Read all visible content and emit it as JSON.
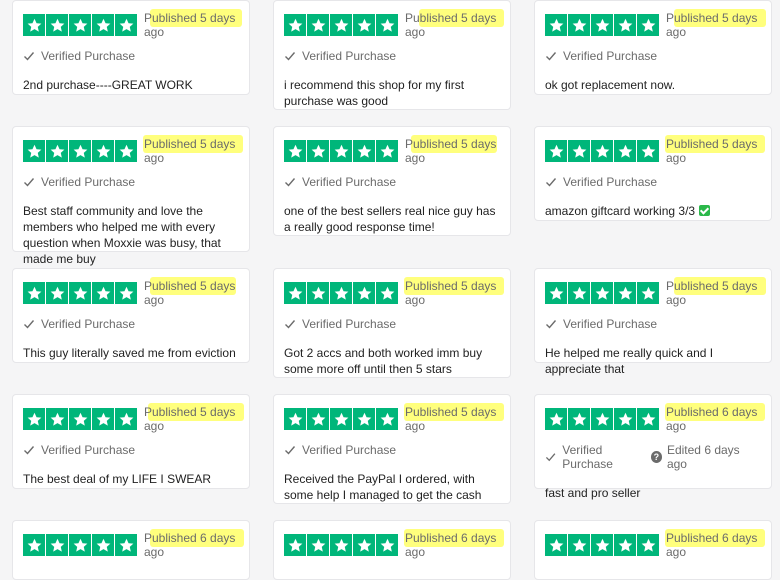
{
  "reviews": [
    {
      "published": "Published 5 days ago",
      "verified": "Verified Purchase",
      "text": "2nd purchase----GREAT WORK",
      "edited": ""
    },
    {
      "published": "Published 5 days ago",
      "verified": "Verified Purchase",
      "text": "i recommend this shop for my first purchase was good",
      "edited": ""
    },
    {
      "published": "Published 5 days ago",
      "verified": "Verified Purchase",
      "text": "ok got replacement now.",
      "edited": ""
    },
    {
      "published": "Published 5 days ago",
      "verified": "Verified Purchase",
      "text": "Best staff community and love the members who helped me with every question when Moxxie was busy, that made me buy",
      "edited": ""
    },
    {
      "published": "Published 5 days ago",
      "verified": "Verified Purchase",
      "text": "one of the best sellers real nice guy has a really good response time!",
      "edited": ""
    },
    {
      "published": "Published 5 days ago",
      "verified": "Verified Purchase",
      "text": "amazon giftcard working 3/3",
      "edited": ""
    },
    {
      "published": "Published 5 days ago",
      "verified": "Verified Purchase",
      "text": "This guy literally saved me from eviction",
      "edited": ""
    },
    {
      "published": "Published 5 days ago",
      "verified": "Verified Purchase",
      "text": "Got 2 accs and both worked imm buy some more off until then 5 stars",
      "edited": ""
    },
    {
      "published": "Published 5 days ago",
      "verified": "Verified Purchase",
      "text": "He helped me really quick and I appreciate that",
      "edited": ""
    },
    {
      "published": "Published 5 days ago",
      "verified": "Verified Purchase",
      "text": "The best deal of my LIFE I SWEAR",
      "edited": ""
    },
    {
      "published": "Published 5 days ago",
      "verified": "Verified Purchase",
      "text": "Received the PayPal I ordered, with some help I managed to get the cash",
      "edited": ""
    },
    {
      "published": "Published 6 days ago",
      "verified": "Verified Purchase",
      "text": "fast and pro seller",
      "edited": "Edited 6 days ago"
    },
    {
      "published": "Published 6 days ago",
      "verified": "",
      "text": "",
      "edited": ""
    },
    {
      "published": "Published 6 days ago",
      "verified": "",
      "text": "",
      "edited": ""
    },
    {
      "published": "Published 6 days ago",
      "verified": "",
      "text": "",
      "edited": ""
    }
  ],
  "rating_stars": 5,
  "colors": {
    "star_bg": "#00b67a",
    "highlight": "#ffff66",
    "checkmark_emoji_bg": "#2bb84a"
  }
}
